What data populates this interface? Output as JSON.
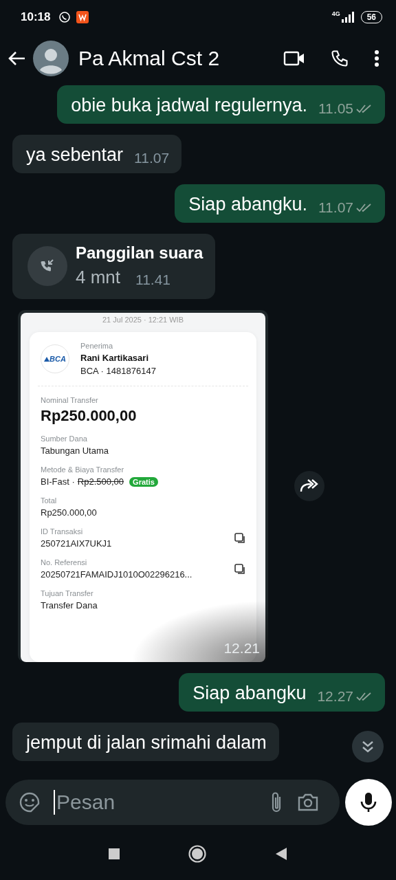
{
  "status_bar": {
    "time": "10:18",
    "network": "4G",
    "battery": "56"
  },
  "header": {
    "contact_name": "Pa Akmal Cst 2"
  },
  "messages": [
    {
      "kind": "text",
      "outgoing": true,
      "text": "obie buka jadwal regulernya.",
      "time": "11.05",
      "read": false
    },
    {
      "kind": "text",
      "outgoing": false,
      "text": "ya sebentar",
      "time": "11.07"
    },
    {
      "kind": "text",
      "outgoing": true,
      "text": "Siap abangku.",
      "time": "11.07",
      "read": false
    },
    {
      "kind": "call",
      "outgoing": false,
      "title": "Panggilan suara",
      "duration": "4 mnt",
      "time": "11.41"
    },
    {
      "kind": "receipt",
      "time": "12.21",
      "receipt": {
        "date": "21 Jul 2025 · 12:21 WIB",
        "recipient_label": "Penerima",
        "recipient_name": "Rani Kartikasari",
        "recipient_account": "BCA · 1481876147",
        "bank_logo": "BCA",
        "fields": [
          {
            "kind": "amount",
            "label": "Nominal Transfer",
            "value": "Rp250.000,00"
          },
          {
            "kind": "plain",
            "label": "Sumber Dana",
            "value": "Tabungan Utama"
          },
          {
            "kind": "fee",
            "label": "Metode & Biaya Transfer",
            "value": "BI-Fast ·",
            "fee": "Rp2.500,00",
            "badge": "Gratis"
          },
          {
            "kind": "plain",
            "label": "Total",
            "value": "Rp250.000,00"
          },
          {
            "kind": "copy",
            "label": "ID Transaksi",
            "value": "250721AIX7UKJ1"
          },
          {
            "kind": "copy",
            "label": "No. Referensi",
            "value": "20250721FAMAIDJ1010O02296216..."
          },
          {
            "kind": "plain",
            "label": "Tujuan Transfer",
            "value": "Transfer Dana"
          }
        ]
      }
    },
    {
      "kind": "text",
      "outgoing": true,
      "text": "Siap abangku",
      "time": "12.27",
      "read": false
    },
    {
      "kind": "text",
      "outgoing": false,
      "text": "jemput di jalan srimahi dalam"
    }
  ],
  "composer": {
    "placeholder": "Pesan"
  }
}
